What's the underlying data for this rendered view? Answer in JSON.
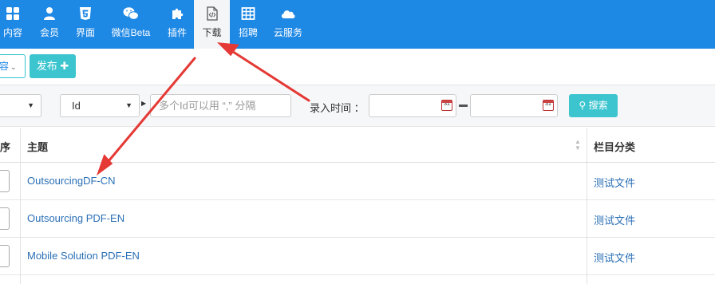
{
  "nav": {
    "items": [
      {
        "label": "内容",
        "icon": "grid-icon"
      },
      {
        "label": "会员",
        "icon": "user-icon"
      },
      {
        "label": "界面",
        "icon": "html5-icon"
      },
      {
        "label": "微信Beta",
        "icon": "wechat-icon"
      },
      {
        "label": "插件",
        "icon": "puzzle-icon"
      },
      {
        "label": "下载",
        "icon": "code-file-icon"
      },
      {
        "label": "招聘",
        "icon": "table-icon"
      },
      {
        "label": "云服务",
        "icon": "cloud-icon"
      }
    ],
    "active_label": "下载",
    "bg_color": "#1e88e5"
  },
  "toolbar": {
    "content_dropdown_label": "容",
    "publish_label": "发布",
    "publish_icon": "plus-icon"
  },
  "filters": {
    "field_select_value": "Id",
    "id_input_placeholder": "多个Id可以用 “,” 分隔",
    "date_label": "录入时间 ：",
    "search_label": "搜索",
    "search_icon": "search-icon"
  },
  "table": {
    "headers": {
      "order": "序",
      "title": "主题",
      "category": "栏目分类"
    },
    "rows": [
      {
        "title": "OutsourcingDF-CN",
        "category": "测试文件"
      },
      {
        "title": "Outsourcing PDF-EN",
        "category": "测试文件"
      },
      {
        "title": "Mobile Solution PDF-EN",
        "category": "测试文件"
      }
    ]
  },
  "annotation_color": "#e53935"
}
